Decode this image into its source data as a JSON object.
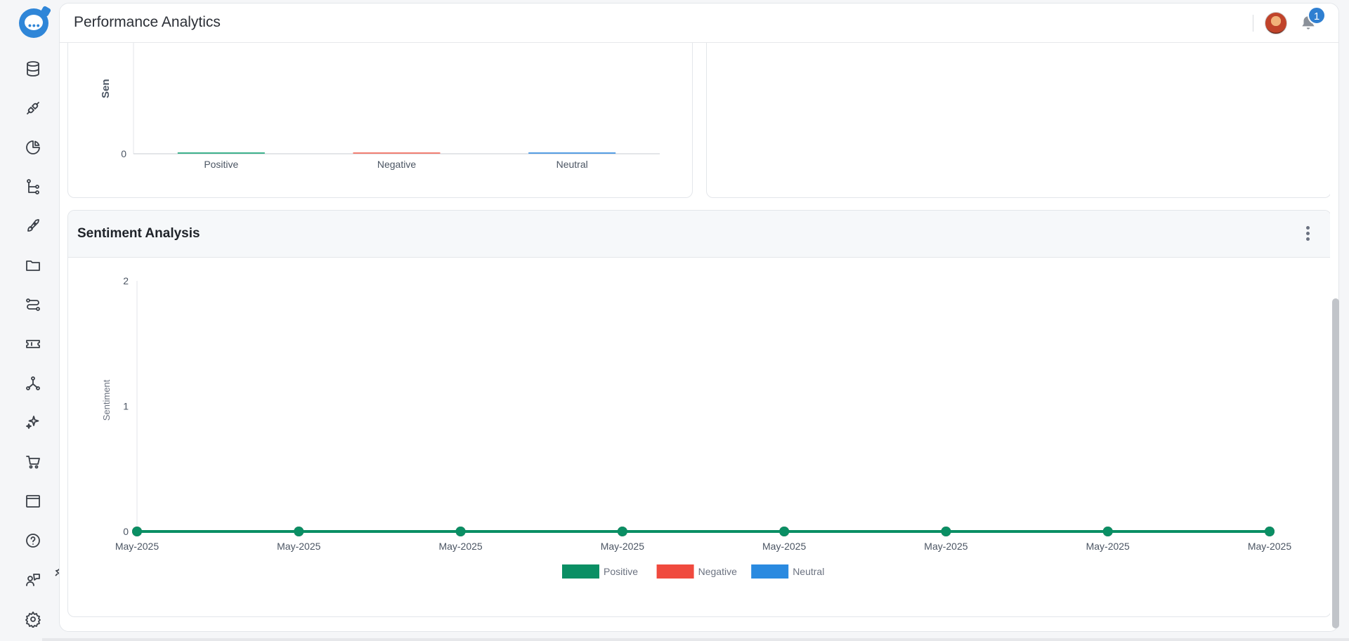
{
  "header": {
    "title": "Performance Analytics",
    "notifications_count": "1"
  },
  "sidebar": {
    "icons": [
      "database-icon",
      "plug-icon",
      "pie-chart-icon",
      "workflow-icon",
      "rocket-icon",
      "folder-icon",
      "route-icon",
      "ticket-icon",
      "network-icon",
      "sparkles-icon",
      "cart-icon",
      "window-icon",
      "help-icon",
      "support-agent-icon",
      "settings-icon"
    ]
  },
  "top_chart": {
    "ylabel": "Sen",
    "chart_data": {
      "type": "bar",
      "categories": [
        "Positive",
        "Negative",
        "Neutral"
      ],
      "values": [
        0,
        0,
        0
      ],
      "y_ticks": [
        "0"
      ],
      "colors": [
        "#1fa67a",
        "#f26b5b",
        "#3b8fe0"
      ]
    }
  },
  "sentiment": {
    "title": "Sentiment Analysis",
    "chart_data": {
      "type": "line",
      "title": "",
      "xlabel": "",
      "ylabel": "Sentiment",
      "ylim": [
        0,
        2
      ],
      "y_ticks": [
        "0",
        "1",
        "2"
      ],
      "x": [
        "May-2025",
        "May-2025",
        "May-2025",
        "May-2025",
        "May-2025",
        "May-2025",
        "May-2025",
        "May-2025"
      ],
      "series": [
        {
          "name": "Positive",
          "color": "#0a8f64",
          "values": [
            0,
            0,
            0,
            0,
            0,
            0,
            0,
            0
          ]
        },
        {
          "name": "Negative",
          "color": "#f04a3e",
          "values": [
            0,
            0,
            0,
            0,
            0,
            0,
            0,
            0
          ]
        },
        {
          "name": "Neutral",
          "color": "#2a8ae0",
          "values": [
            0,
            0,
            0,
            0,
            0,
            0,
            0,
            0
          ]
        }
      ],
      "legend": "bottom"
    }
  }
}
